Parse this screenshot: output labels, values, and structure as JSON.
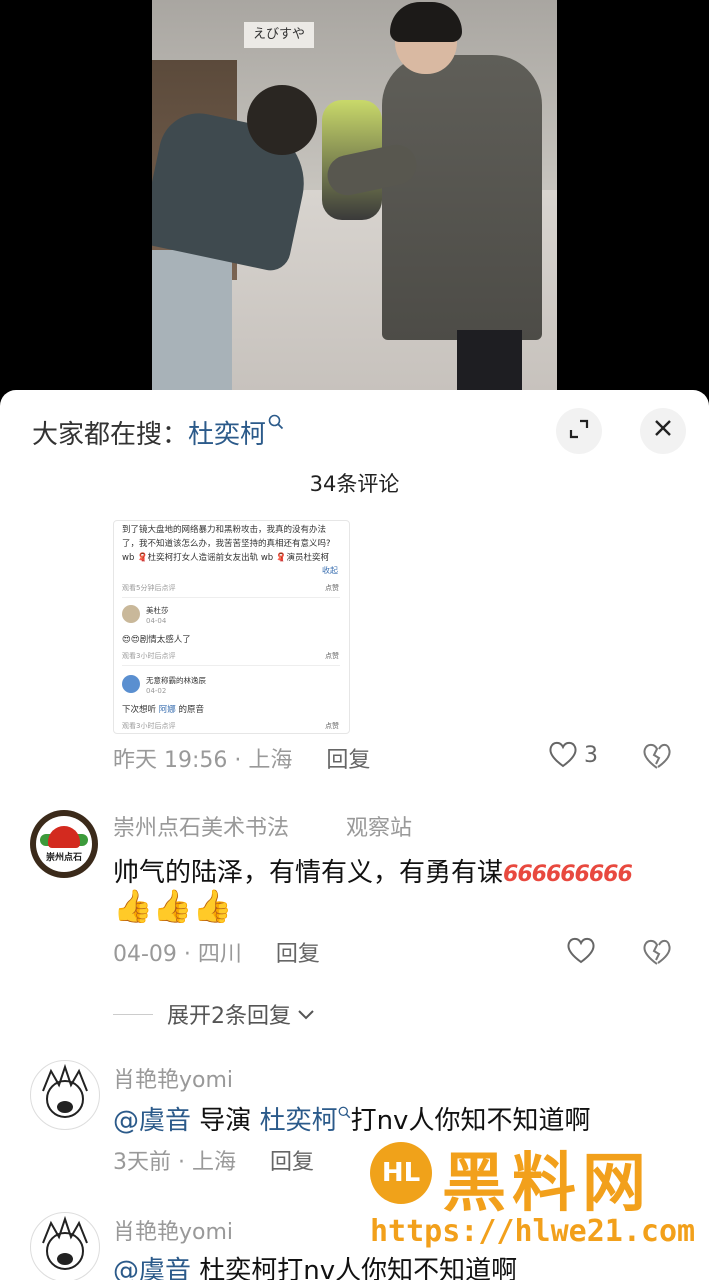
{
  "video": {
    "sign_text": "えびすや"
  },
  "panel": {
    "search_prefix": "大家都在搜：",
    "search_term": "杜奕柯",
    "comment_count": "34条评论"
  },
  "embedded_screenshot": {
    "line1": "到了镜大盘地的网络暴力和黑粉攻击，我真的没有办法",
    "line2": "了，我不知道该怎么办，我苦苦坚持的真相还有意义吗?",
    "line3": "wb 🧣杜奕柯打女人造谣前女友出轨 wb 🧣演员杜奕柯",
    "collapse": "收起",
    "rating1": "观看5分钟后点评",
    "like": "点赞",
    "user2": "美杜莎",
    "date2": "04-04",
    "text2": "😍😍剧情太感人了",
    "rating2": "观看3小时后点评",
    "user3": "无意称霸的林逸辰",
    "date3": "04-02",
    "text3_prefix": "下次想听",
    "text3_mention": "阿娜",
    "text3_suffix": "的原音",
    "rating3": "观看3小时后点评"
  },
  "comments": [
    {
      "time_location": "昨天 19:56 · 上海",
      "reply": "回复",
      "likes": "3"
    },
    {
      "username": "崇州点石美术书法",
      "badge": "观察站",
      "text": "帅气的陆泽，有情有义，有勇有谋",
      "six_tokens": "666666666",
      "thumbs": "👍👍👍",
      "time_location": "04-09 · 四川",
      "reply": "回复",
      "expand": "展开2条回复",
      "avatar_text": "崇州点石"
    },
    {
      "username": "肖艳艳yomi",
      "mention": "@虞音",
      "text_middle": "导演",
      "mention2": "杜奕柯",
      "text_end": "打nv人你知不知道啊",
      "time_location": "3天前 · 上海",
      "reply": "回复"
    },
    {
      "username": "肖艳艳yomi",
      "mention": "@虞音",
      "text": "杜奕柯打nv人你知不知道啊"
    }
  ],
  "watermark": {
    "logo": "HL",
    "title": "黑料网",
    "url": "https://hlwe21.com"
  },
  "colors": {
    "link": "#2b5a8a",
    "accent_watermark": "#f2a01b",
    "six_red": "#e8493f"
  },
  "icons": [
    "search-icon",
    "expand-icon",
    "close-icon",
    "heart-icon",
    "broken-heart-icon",
    "chevron-down-icon"
  ]
}
